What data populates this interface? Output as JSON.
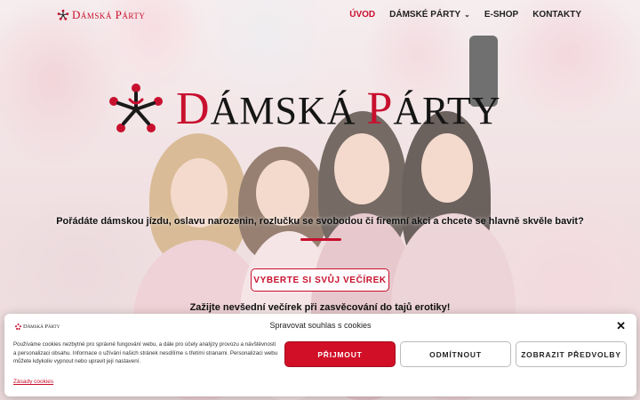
{
  "header": {
    "brand": "Dámská Párty",
    "nav": [
      {
        "label": "ÚVOD",
        "active": true
      },
      {
        "label": "DÁMSKÉ PÁRTY",
        "dropdown": true
      },
      {
        "label": "E-SHOP"
      },
      {
        "label": "KONTAKTY"
      }
    ]
  },
  "hero": {
    "logo_text": "Dámská Párty",
    "tagline": "Pořádáte dámskou jízdu, oslavu narozenin, rozlučku se svobodou či firemní akci a chcete se hlavně skvěle bavit?",
    "cta_label": "VYBERTE SI SVŮJ VEČÍREK",
    "subline": "Zažijte nevšední večírek při zasvěcování do tajů erotiky!"
  },
  "cookie": {
    "brand": "Dámská Párty",
    "title": "Spravovat souhlas s cookies",
    "text": "Používáme cookies nezbytné pro správné fungování webu, a dále pro účely analýzy provozu a návštěvnosti a personalizaci obsahu. Informace o užívání našich stránek nesdílíme s třetími stranami. Personalizaci webu můžete kdykoliv vypnout nebo upravit její nastavení.",
    "accept_label": "PŘIJMOUT",
    "deny_label": "ODMÍTNOUT",
    "prefs_label": "ZOBRAZIT PŘEDVOLBY",
    "policy_link": "Zásady cookies"
  },
  "colors": {
    "accent": "#c8102e",
    "text": "#111111"
  },
  "icons": {
    "logo": "dancing-figures-emblem",
    "close": "close-icon",
    "dropdown": "chevron-down-icon"
  }
}
